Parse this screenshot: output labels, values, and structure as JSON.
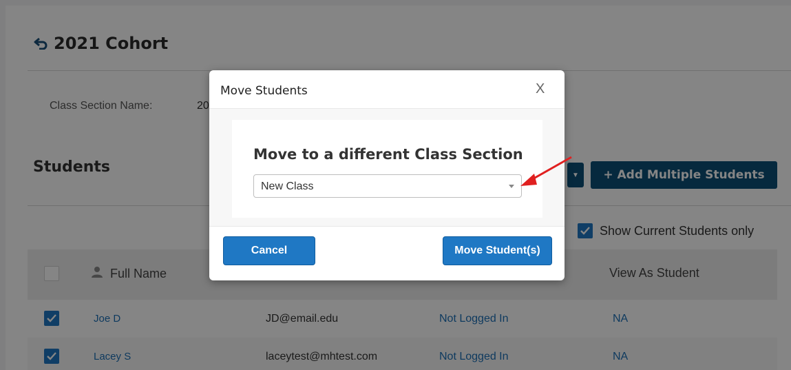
{
  "header": {
    "title": "2021 Cohort",
    "back_icon": "back-arrow-icon"
  },
  "section": {
    "label": "Class Section Name:",
    "value_visible": "20"
  },
  "students": {
    "heading": "Students",
    "dropdown_icon": "caret-down-icon",
    "add_multiple_label": "+ Add Multiple Students",
    "show_current_label": "Show Current Students only",
    "show_current_checked": true
  },
  "table": {
    "columns": {
      "name": "Full Name",
      "view": "View As Student"
    },
    "rows": [
      {
        "name": "Joe D",
        "email": "JD@email.edu",
        "status": "Not Logged In",
        "view": "NA",
        "checked": true
      },
      {
        "name": "Lacey S",
        "email": "laceytest@mhtest.com",
        "status": "Not Logged In",
        "view": "NA",
        "checked": true
      }
    ]
  },
  "modal": {
    "title": "Move Students",
    "close_label": "X",
    "body_heading": "Move to a different Class Section",
    "select_value": "New Class",
    "cancel_label": "Cancel",
    "move_label": "Move Student(s)"
  },
  "colors": {
    "accent": "#1f78c4",
    "dark_button": "#0d4f78",
    "link": "#1c6fb6",
    "annotation_arrow": "#e02020"
  }
}
